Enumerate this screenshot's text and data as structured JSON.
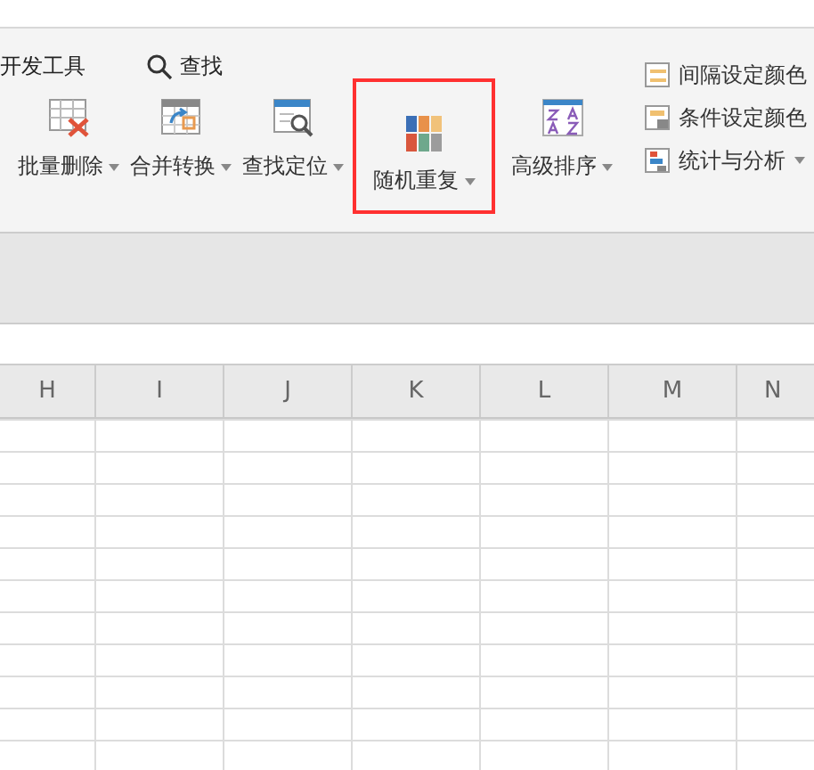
{
  "ribbon_tabs": [
    {
      "label": "开发工具",
      "kind": "tab"
    },
    {
      "label": "查找",
      "kind": "search"
    }
  ],
  "tools": [
    {
      "label": "批量删除",
      "dropdown": true,
      "highlighted": false
    },
    {
      "label": "合并转换",
      "dropdown": true,
      "highlighted": false
    },
    {
      "label": "查找定位",
      "dropdown": true,
      "highlighted": false
    },
    {
      "label": "随机重复",
      "dropdown": true,
      "highlighted": true
    },
    {
      "label": "高级排序",
      "dropdown": true,
      "highlighted": false
    }
  ],
  "side_tools": [
    {
      "label": "间隔设定颜色",
      "dropdown": false
    },
    {
      "label": "条件设定颜色",
      "dropdown": false
    },
    {
      "label": "统计与分析",
      "dropdown": true
    }
  ],
  "column_headers": [
    "H",
    "I",
    "J",
    "K",
    "L",
    "M",
    "N"
  ]
}
